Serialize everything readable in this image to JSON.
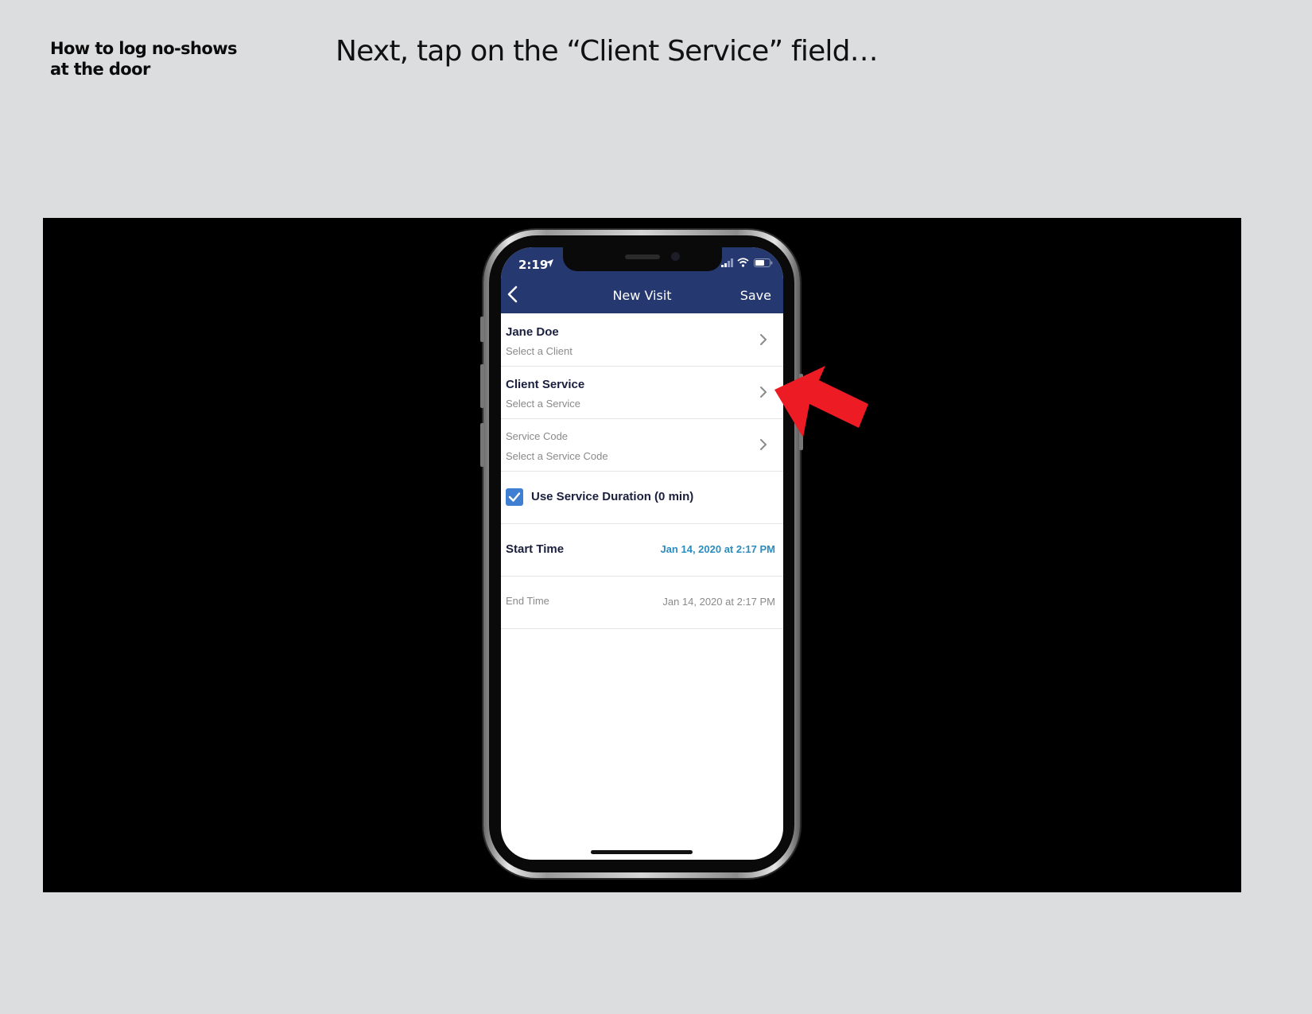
{
  "guide": {
    "title_line1": "How to log no-shows",
    "title_line2": "at the door",
    "instruction": "Next, tap on the “Client Service” field…"
  },
  "status_bar": {
    "time": "2:19",
    "icons": [
      "location-arrow-icon",
      "signal-icon",
      "wifi-icon",
      "battery-icon"
    ]
  },
  "navbar": {
    "title": "New Visit",
    "save_label": "Save",
    "back_icon": "chevron-left-icon",
    "color": "#263870"
  },
  "form": {
    "client": {
      "label": "Jane Doe",
      "sub": "Select a Client"
    },
    "client_service": {
      "label": "Client Service",
      "sub": "Select a Service"
    },
    "service_code": {
      "label": "Service Code",
      "sub": "Select a Service Code"
    },
    "use_duration": {
      "label": "Use Service Duration (0 min)",
      "checked": true
    },
    "start_time": {
      "label": "Start Time",
      "value": "Jan 14, 2020 at 2:17 PM"
    },
    "end_time": {
      "label": "End Time",
      "value": "Jan 14, 2020 at 2:17 PM"
    }
  },
  "annotation": {
    "icon": "red-arrow-icon",
    "color": "#ed1c24"
  }
}
